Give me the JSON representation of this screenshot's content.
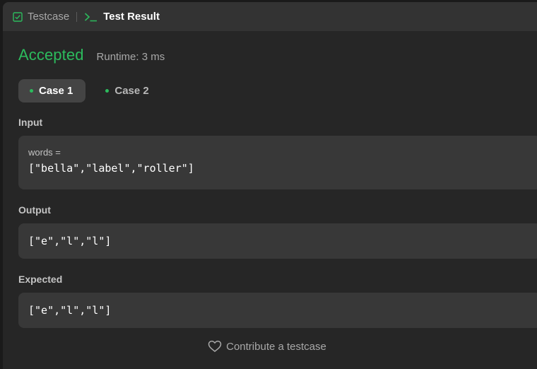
{
  "tabs": [
    {
      "label": "Testcase",
      "icon": "checkbox-icon",
      "active": false
    },
    {
      "label": "Test Result",
      "icon": "terminal-icon",
      "active": true
    }
  ],
  "result": {
    "status": "Accepted",
    "runtime": "Runtime: 3 ms"
  },
  "cases": [
    {
      "label": "Case 1",
      "selected": true
    },
    {
      "label": "Case 2",
      "selected": false
    }
  ],
  "input": {
    "label": "Input",
    "var_name": "words =",
    "value": "[\"bella\",\"label\",\"roller\"]"
  },
  "output": {
    "label": "Output",
    "value": "[\"e\",\"l\",\"l\"]"
  },
  "expected": {
    "label": "Expected",
    "value": "[\"e\",\"l\",\"l\"]"
  },
  "footer": {
    "contribute_label": "Contribute a testcase",
    "icon": "heart-icon"
  },
  "colors": {
    "accent_green": "#2cbb5d",
    "panel_bg": "#262626",
    "tabbar_bg": "#333333",
    "box_bg": "#383838"
  }
}
